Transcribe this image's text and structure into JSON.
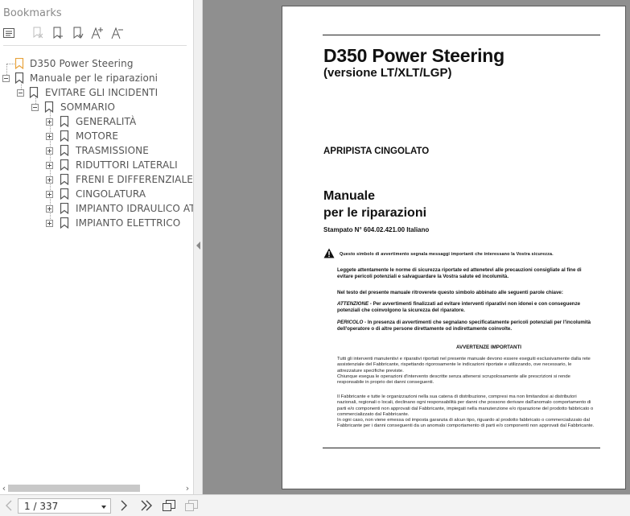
{
  "bookmarks_panel": {
    "title": "Bookmarks",
    "toolbar": [
      {
        "icon": "options-menu-icon",
        "enabled": true
      },
      {
        "icon": "delete-bookmark-icon",
        "enabled": false
      },
      {
        "icon": "new-bookmark-icon",
        "enabled": true
      },
      {
        "icon": "new-bookmark-from-structure-icon",
        "enabled": true
      },
      {
        "icon": "increase-text-size-icon",
        "enabled": true
      },
      {
        "icon": "decrease-text-size-icon",
        "enabled": true
      }
    ],
    "tree": [
      {
        "label": "D350 Power Steering",
        "level": 0,
        "expander": "none",
        "flag_color": "#e8a33d"
      },
      {
        "label": "Manuale per le riparazioni",
        "level": 0,
        "expander": "minus"
      },
      {
        "label": "EVITARE GLI INCIDENTI",
        "level": 1,
        "expander": "minus"
      },
      {
        "label": "SOMMARIO",
        "level": 2,
        "expander": "minus"
      },
      {
        "label": "GENERALITÀ",
        "level": 3,
        "expander": "plus"
      },
      {
        "label": "MOTORE",
        "level": 3,
        "expander": "plus"
      },
      {
        "label": "TRASMISSIONE",
        "level": 3,
        "expander": "plus"
      },
      {
        "label": "RIDUTTORI LATERALI",
        "level": 3,
        "expander": "plus"
      },
      {
        "label": "FRENI E DIFFERENZIALE D",
        "level": 3,
        "expander": "plus"
      },
      {
        "label": "CINGOLATURA",
        "level": 3,
        "expander": "plus"
      },
      {
        "label": "IMPIANTO IDRAULICO ATT",
        "level": 3,
        "expander": "plus"
      },
      {
        "label": "IMPIANTO ELETTRICO",
        "level": 3,
        "expander": "plus"
      }
    ]
  },
  "document": {
    "title": "D350 Power Steering",
    "subtitle": "(versione LT/XLT/LGP)",
    "machine": "APRIPISTA CINGOLATO",
    "manual_line1": "Manuale",
    "manual_line2": "per le riparazioni",
    "stampato": "Stampato  N° 604.02.421.00   Italiano",
    "warning_symbol_text": "Questo simbolo di avvertimento segnala messaggi importanti che interessano la Vostra sicurezza.",
    "para_read": "Leggete attentamente le norme di sicurezza riportate ed attenetevi alle precauzioni consigliate al fine di evitare pericoli potenziali e salvaguardare la Vostra salute ed incolumità.",
    "para_symbol": "Nel testo del presente manuale ritroverete questo simbolo abbinato alle seguenti parole chiave:",
    "attenzione_label": "ATTENZIONE",
    "attenzione_text": " - Per avvertimenti finalizzati ad evitare interventi riparativi non idonei e con conseguenze potenziali che coinvolgono la sicurezza del riparatore.",
    "pericolo_label": "PERICOLO",
    "pericolo_text": " - In presenza di avvertimenti che segnalano specificatamente pericoli potenziali per l'incolumità dell'operatore o di altre persone direttamente od indirettamente coinvolte.",
    "avvertenze_heading": "AVVERTENZE IMPORTANTI",
    "avv_para1": "Tutti gli interventi manutentivi e riparativi riportati nel presente manuale devono essere eseguiti esclusivamente dalla rete assistenziale del Fabbricante, rispettando rigorosamente le indicazioni riportate e utilizzando, ove necessario, le attrezzature specifiche previste.",
    "avv_para2": "Chiunque esegua le operazioni d'intervento descritte senza attenersi scrupolosamente alle prescrizioni si rende responsabile in proprio dei danni conseguenti.",
    "avv_para3": "Il Fabbricante e tutte le organizzazioni nella sua catena di distribuzione, compresi ma non limitandosi ai distributori nazionali, regionali o locali, declinano ogni responsabilità per danni che possono derivare dall'anomalo comportamento di parti e/o componenti non approvati dal Fabbricante, impiegati nella manutenzione e/o riparazione del prodotto fabbricato o commercializzato dal Fabbricante.",
    "avv_para4": "In ogni caso, non viene emessa od imposta garanzia di alcun tipo, riguardo al prodotto fabbricato o commercializzato dal Fabbricante per i danni conseguenti da un anomalo comportamento di parti e/o componenti non approvati dal Fabbricante."
  },
  "navigation": {
    "current_page": "1",
    "page_count_text": "/ 337",
    "icons": [
      "previous-page-icon",
      "next-page-icon",
      "last-page-icon",
      "fit-page-icon",
      "rotate-icon"
    ]
  }
}
